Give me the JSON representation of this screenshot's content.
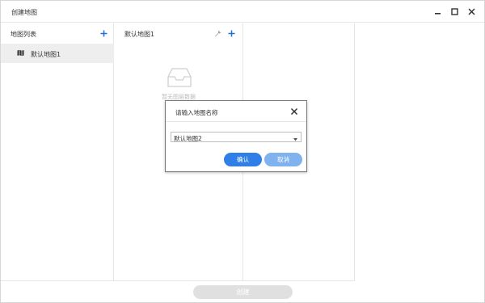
{
  "window": {
    "title": "创建地图",
    "controls": {
      "minimize_icon": "minimize-icon",
      "maximize_icon": "maximize-icon",
      "close_icon": "close-icon"
    }
  },
  "left_panel": {
    "header": "地图列表",
    "add_icon": "plus-icon",
    "items": [
      {
        "label": "默认地图1",
        "icon": "map-icon",
        "selected": true
      }
    ]
  },
  "middle_panel": {
    "header": "默认地图1",
    "wrench_icon": "wrench-icon",
    "add_icon": "plus-icon",
    "empty_icon": "inbox-icon",
    "empty_text": "暂无图层数据"
  },
  "footer": {
    "create_label": "创建"
  },
  "dialog": {
    "title": "请输入地图名称",
    "close_icon": "close-icon",
    "select": {
      "value": "默认地图2"
    },
    "confirm_label": "确认",
    "cancel_label": "取消"
  },
  "colors": {
    "accent": "#2f7fe6",
    "accent_light": "#7fb2ef",
    "selected_bg": "#eeeeee",
    "disabled_btn": "#e0e0e0",
    "plus_blue": "#1e6fd9"
  }
}
